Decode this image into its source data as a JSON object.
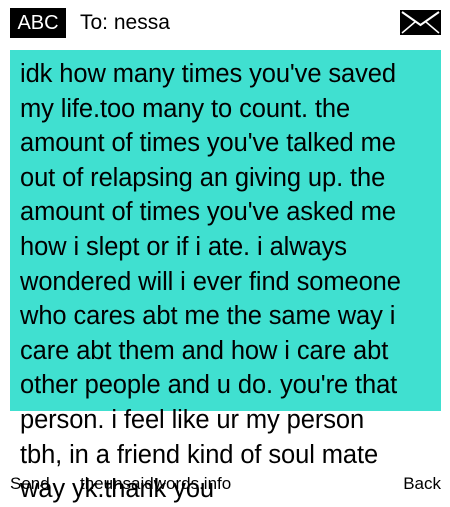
{
  "header": {
    "input_mode": "ABC",
    "recipient": "To: nessa",
    "status_icon": "envelope-icon"
  },
  "message": {
    "text": "idk how many times you've saved\nmy life.too many to count. the\namount of times you've talked me\nout of relapsing an giving up. the\namount of times you've asked me\nhow i slept or if i ate. i always\nwondered will i ever find someone\nwho cares abt me the same way i\ncare abt them and how i care abt\nother people and u do. you're that\nperson. i feel like ur my person\ntbh, in a friend kind of soul mate\nway yk.thank you",
    "bubble_color": "#40e0d0"
  },
  "softkeys": {
    "left": "Send",
    "center": "theunsaidwords.info",
    "right": "Back"
  }
}
